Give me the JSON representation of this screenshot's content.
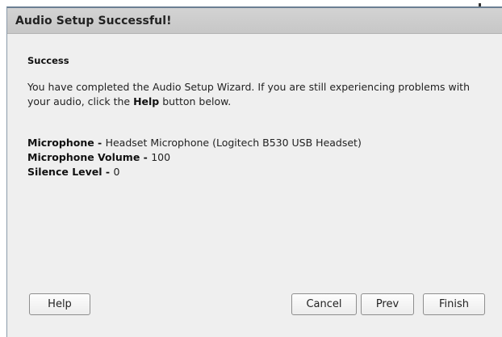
{
  "dialog": {
    "title": "Audio Setup Successful!"
  },
  "content": {
    "heading": "Success",
    "message_part1": "You have completed the Audio Setup Wizard. If you are still experiencing problems with your audio, click the ",
    "message_bold": "Help",
    "message_part2": " button below.",
    "details": [
      {
        "label": "Microphone - ",
        "value": "Headset Microphone (Logitech B530 USB Headset)"
      },
      {
        "label": "Microphone Volume - ",
        "value": "100"
      },
      {
        "label": "Silence Level - ",
        "value": "0"
      }
    ]
  },
  "buttons": {
    "help": "Help",
    "cancel": "Cancel",
    "prev": "Prev",
    "finish": "Finish"
  }
}
